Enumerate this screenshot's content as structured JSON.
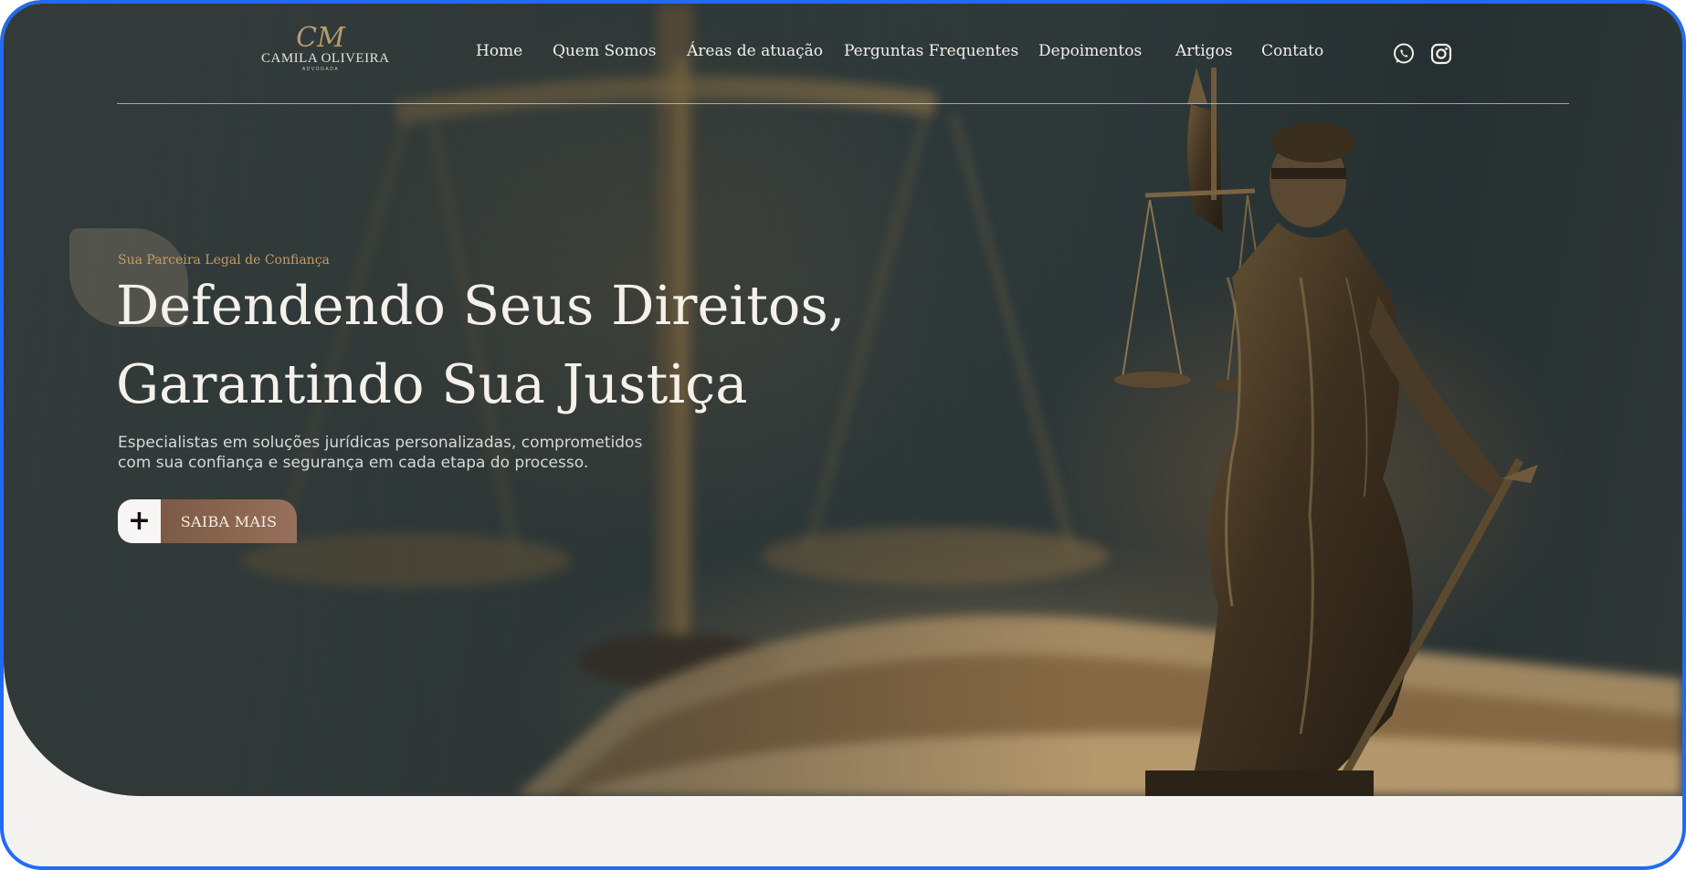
{
  "brand": {
    "name": "CAMILA OLIVEIRA",
    "tagline": "ADVOGADA",
    "monogram": "CM",
    "accent_color": "#c99a62",
    "button_color": "#8a6550"
  },
  "nav": {
    "items": [
      {
        "label": "Home"
      },
      {
        "label": "Quem Somos"
      },
      {
        "label": "Áreas de atuação"
      },
      {
        "label": "Perguntas Frequentes"
      },
      {
        "label": "Depoimentos"
      },
      {
        "label": "Artigos"
      },
      {
        "label": "Contato"
      }
    ],
    "social": [
      {
        "icon": "whatsapp-icon"
      },
      {
        "icon": "instagram-icon"
      }
    ]
  },
  "hero": {
    "eyebrow": "Sua Parceira Legal de Confiança",
    "headline_line1": "Defendendo Seus Direitos,",
    "headline_line2": "Garantindo Sua Justiça",
    "subtext_line1": "Especialistas em soluções jurídicas personalizadas, comprometidos",
    "subtext_line2": "com sua confiança e segurança em cada etapa do processo.",
    "cta_icon": "+",
    "cta_label": "SAIBA MAIS"
  }
}
